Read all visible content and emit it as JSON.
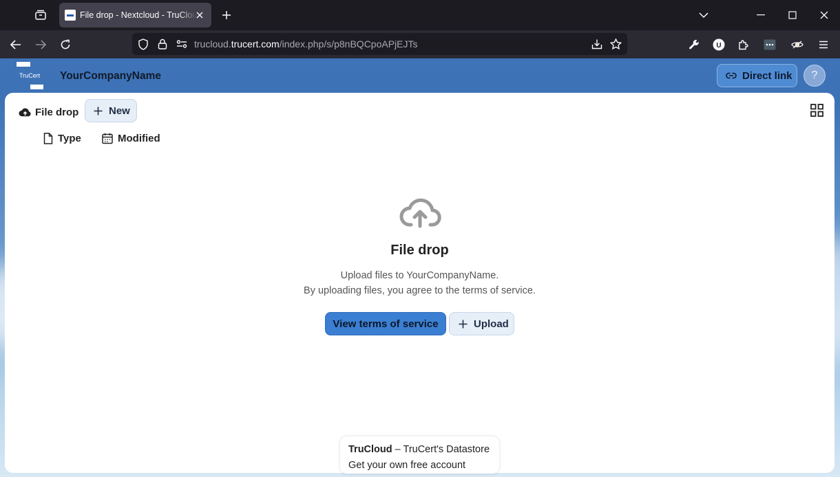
{
  "browser": {
    "tab_title": "File drop - Nextcloud - TruCloud",
    "url_host_prefix": "trucloud.",
    "url_host_main": "trucert.com",
    "url_path": "/index.php/s/p8nBQCpoAPjEJTs"
  },
  "header": {
    "logo_text": "TruCert",
    "company_name": "YourCompanyName",
    "direct_link_label": "Direct link",
    "help_label": "?"
  },
  "toolbar": {
    "breadcrumb_label": "File drop",
    "new_label": "New"
  },
  "columns": {
    "type_label": "Type",
    "modified_label": "Modified"
  },
  "empty_state": {
    "title": "File drop",
    "line1": "Upload files to YourCompanyName.",
    "line2": "By uploading files, you agree to the terms of service.",
    "tos_label": "View terms of service",
    "upload_label": "Upload"
  },
  "footer": {
    "brand": "TruCloud",
    "tagline": " – TruCert's Datastore",
    "cta": "Get your own free account"
  }
}
